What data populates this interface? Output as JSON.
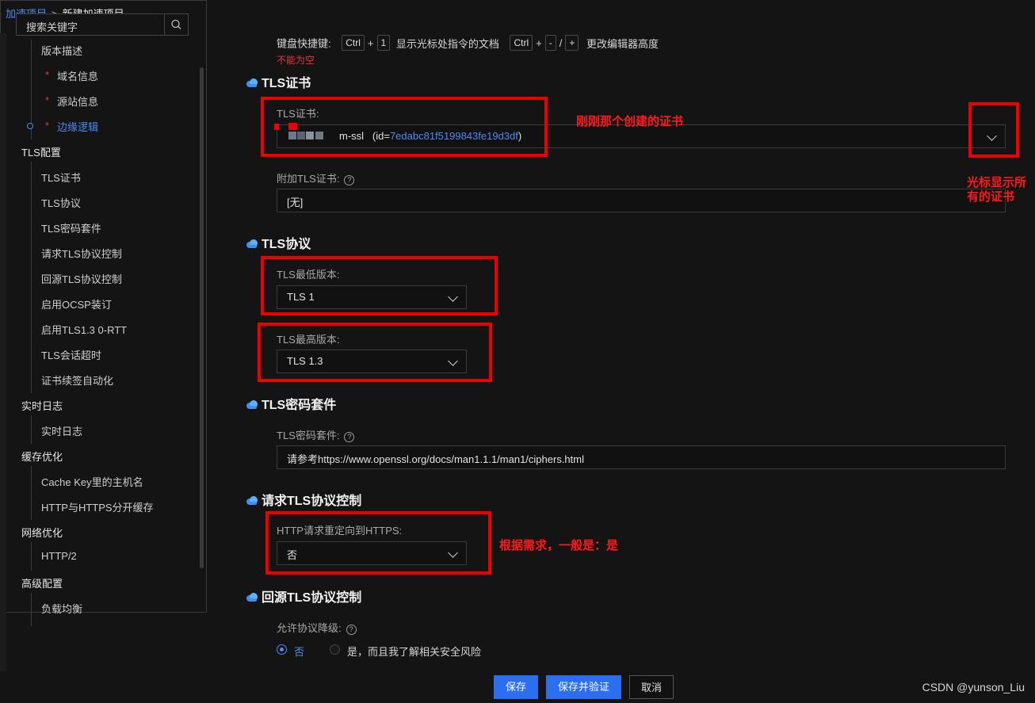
{
  "breadcrumb": {
    "parent": "加速项目",
    "separator": ">",
    "current": "新建加速项目"
  },
  "sidebar": {
    "search_placeholder": "搜索关键字",
    "items": [
      {
        "label": "版本描述",
        "type": "item"
      },
      {
        "label": "域名信息",
        "type": "item",
        "required": true
      },
      {
        "label": "源站信息",
        "type": "item",
        "required": true
      },
      {
        "label": "边缘逻辑",
        "type": "item",
        "required": true,
        "active": true
      },
      {
        "label": "TLS配置",
        "type": "group"
      },
      {
        "label": "TLS证书",
        "type": "item"
      },
      {
        "label": "TLS协议",
        "type": "item"
      },
      {
        "label": "TLS密码套件",
        "type": "item"
      },
      {
        "label": "请求TLS协议控制",
        "type": "item"
      },
      {
        "label": "回源TLS协议控制",
        "type": "item"
      },
      {
        "label": "启用OCSP装订",
        "type": "item"
      },
      {
        "label": "启用TLS1.3 0-RTT",
        "type": "item"
      },
      {
        "label": "TLS会话超时",
        "type": "item"
      },
      {
        "label": "证书续签自动化",
        "type": "item"
      },
      {
        "label": "实时日志",
        "type": "group"
      },
      {
        "label": "实时日志",
        "type": "item"
      },
      {
        "label": "缓存优化",
        "type": "group"
      },
      {
        "label": "Cache Key里的主机名",
        "type": "item"
      },
      {
        "label": "HTTP与HTTPS分开缓存",
        "type": "item"
      },
      {
        "label": "网络优化",
        "type": "group"
      },
      {
        "label": "HTTP/2",
        "type": "item"
      },
      {
        "label": "高级配置",
        "type": "group"
      },
      {
        "label": "负载均衡",
        "type": "item"
      }
    ]
  },
  "editor_hint": {
    "prefix": "键盘快捷键:",
    "key_ctrl": "Ctrl",
    "plus": "+",
    "key_1": "1",
    "desc1": "显示光标处指令的文档",
    "key_minus": "-",
    "slash": "/",
    "key_plus": "+",
    "desc2": "更改编辑器高度"
  },
  "error_text": "不能为空",
  "sections": {
    "tls_cert": {
      "title": "TLS证书",
      "label": "TLS证书:",
      "value_name": "m-ssl",
      "value_id_prefix": "(id=",
      "value_id": "7edabc81f5199843fe19d3df",
      "value_id_suffix": ")",
      "extra_label": "附加TLS证书:",
      "extra_value": "[无]"
    },
    "tls_protocol": {
      "title": "TLS协议",
      "min_label": "TLS最低版本:",
      "min_value": "TLS 1",
      "max_label": "TLS最高版本:",
      "max_value": "TLS 1.3"
    },
    "tls_cipher": {
      "title": "TLS密码套件",
      "label": "TLS密码套件:",
      "placeholder": "请参考https://www.openssl.org/docs/man1.1.1/man1/ciphers.html"
    },
    "request_tls": {
      "title": "请求TLS协议控制",
      "label": "HTTP请求重定向到HTTPS:",
      "value": "否"
    },
    "origin_tls": {
      "title": "回源TLS协议控制",
      "label": "允许协议降级:",
      "options": [
        "否",
        "是，而且我了解相关安全风险"
      ],
      "selected": "否"
    }
  },
  "annotations": {
    "cert_note": "刚刚那个创建的证书",
    "dropdown_note": "光标显示所有的证书",
    "redirect_note": "根据需求，一般是：是"
  },
  "footer": {
    "save": "保存",
    "save_verify": "保存并验证",
    "cancel": "取消"
  },
  "watermark": "CSDN @yunson_Liu",
  "colors": {
    "accent": "#2b6ff0",
    "link": "#4c8cf5",
    "annotation": "#ee0000",
    "background": "#141414"
  }
}
